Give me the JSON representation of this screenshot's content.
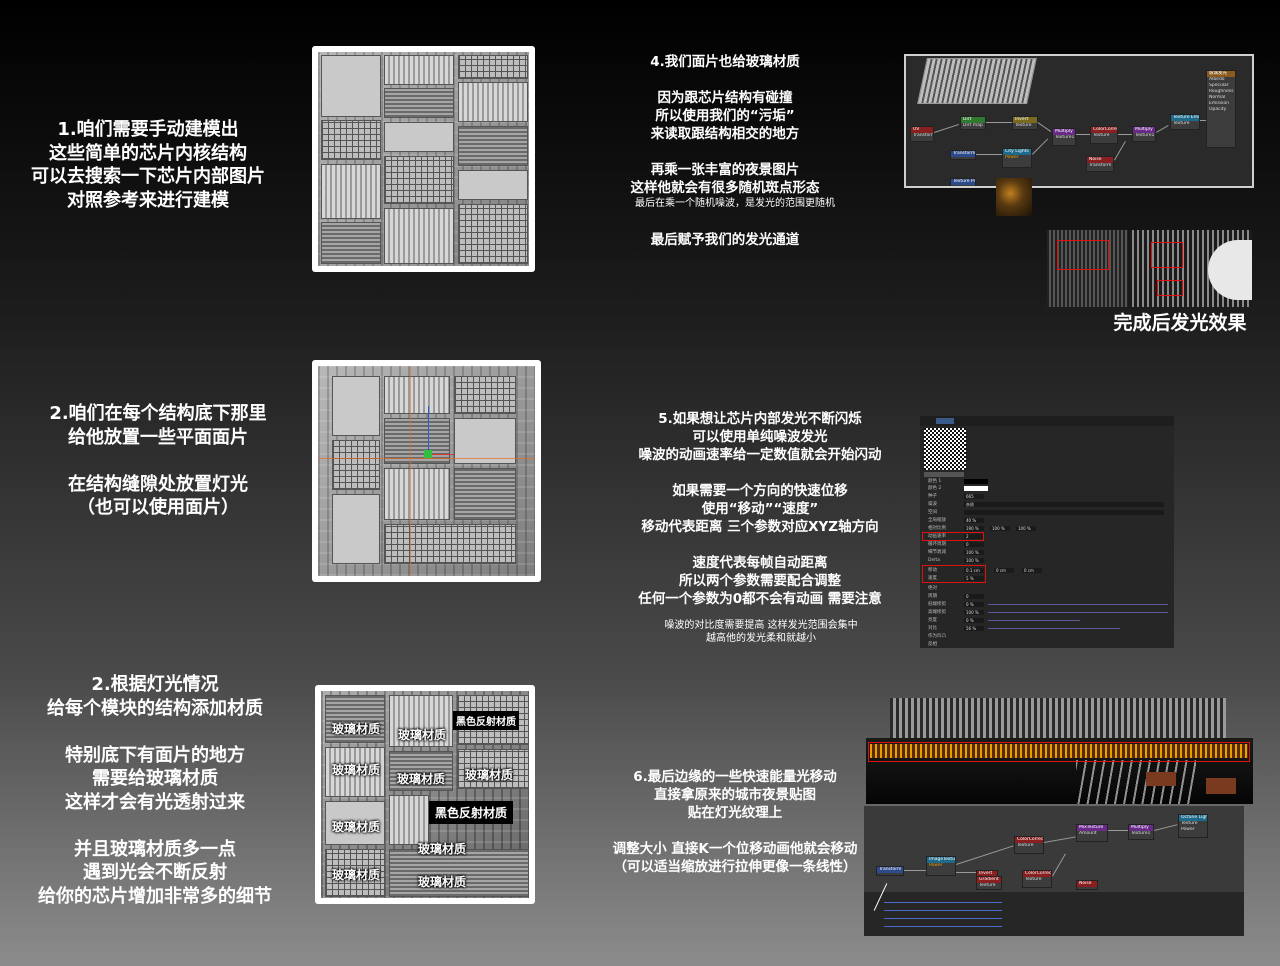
{
  "section1": {
    "text": "1.咱们需要手动建模出\n这些简单的芯片内核结构\n可以去搜索一下芯片内部图片\n对照参考来进行建模"
  },
  "section2": {
    "text": "2.咱们在每个结构底下那里\n给他放置一些平面面片\n\n在结构缝隙处放置灯光\n（也可以使用面片）"
  },
  "section3": {
    "text": "2.根据灯光情况\n给每个模块的结构添加材质\n\n特别底下有面片的地方\n需要给玻璃材质\n这样才会有光透射过来\n\n并且玻璃材质多一点\n遇到光会不断反射\n给你的芯片增加非常多的细节"
  },
  "section4": {
    "text_a": "4.我们面片也给玻璃材质\n\n因为跟芯片结构有碰撞\n所以使用我们的“污垢”\n来读取跟结构相交的地方\n\n再乘一张丰富的夜景图片\n这样他就会有很多随机斑点形态",
    "text_b": "最后在乘一个随机噪波，是发光的范围更随机",
    "text_c": "最后赋予我们的发光通道",
    "result_label": "完成后发光效果"
  },
  "section5": {
    "text_a": "5.如果想让芯片内部发光不断闪烁\n可以使用单纯噪波发光\n噪波的动画速率给一定数值就会开始闪动\n\n如果需要一个方向的快速位移\n使用“移动”“速度”\n移动代表距离 三个参数对应XYZ轴方向\n\n速度代表每帧自动距离\n所以两个参数需要配合调整\n任何一个参数为0都不会有动画 需要注意",
    "text_b": "噪波的对比度需要提高 这样发光范围会集中\n越高他的发光柔和就越小"
  },
  "section6": {
    "text": "6.最后边缘的一些快速能量光移动\n直接拿原来的城市夜景贴图\n贴在灯光纹理上\n\n调整大小 直接K一个位移动画他就会移动\n（可以适当缩放进行拉伸更像一条线性）"
  },
  "materials": {
    "glass": "玻璃材质",
    "black_reflect": "黑色反射材质"
  },
  "colors": {
    "highlight": "#e01010",
    "accent": "#e6a000"
  }
}
